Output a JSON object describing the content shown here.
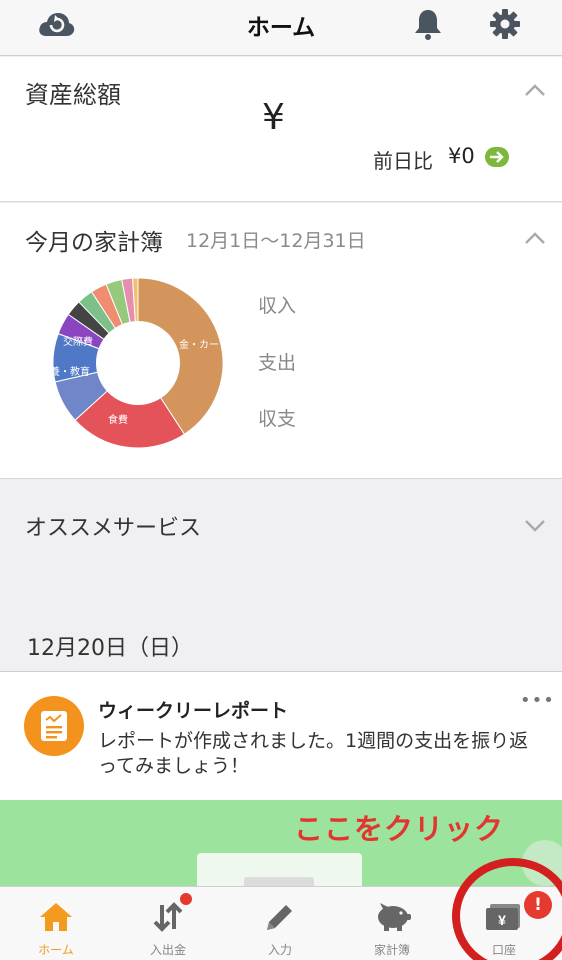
{
  "header": {
    "title": "ホーム"
  },
  "asset": {
    "title": "資産総額",
    "amount": "¥",
    "diff_label": "前日比",
    "diff_value": "¥0"
  },
  "kakeibo": {
    "title": "今月の家計簿",
    "range": "12月1日〜12月31日",
    "legend": [
      "収入",
      "支出",
      "収支"
    ],
    "slice_labels": [
      "金・カー",
      "食費",
      "教養・教育",
      "交際費"
    ]
  },
  "chart_data": {
    "type": "pie",
    "categories": [
      "金・カー",
      "食費",
      "教養・教育",
      "交際費",
      "",
      "",
      "",
      "",
      "",
      "",
      ""
    ],
    "values": [
      40,
      22,
      8,
      9,
      4,
      3,
      3,
      3,
      3,
      2,
      1
    ],
    "colors": [
      "#d3955c",
      "#e5535a",
      "#6f86c8",
      "#4f79c6",
      "#8b45c0",
      "#444444",
      "#7ec08a",
      "#f08c70",
      "#96c97c",
      "#e78eaf",
      "#f0c070"
    ],
    "hole": "donut"
  },
  "osusume": {
    "title": "オススメサービス"
  },
  "date_label": "12月20日（日）",
  "report": {
    "title": "ウィークリーレポート",
    "body": "レポートが作成されました。1週間の支出を振り返ってみましょう！",
    "more": "•••"
  },
  "banner": {
    "annotation": "ここをクリック"
  },
  "tabs": [
    {
      "label": "ホーム",
      "icon": "home-icon",
      "active": true
    },
    {
      "label": "入出金",
      "icon": "transfer-icon",
      "dot": true
    },
    {
      "label": "入力",
      "icon": "pencil-icon"
    },
    {
      "label": "家計簿",
      "icon": "piggy-bank-icon"
    },
    {
      "label": "口座",
      "icon": "wallet-yen-icon",
      "badge": "!"
    }
  ],
  "colors": {
    "accent": "#f39a1f",
    "alert": "#e53a2f",
    "banner": "#9ce39d",
    "green": "#7cb83c"
  }
}
